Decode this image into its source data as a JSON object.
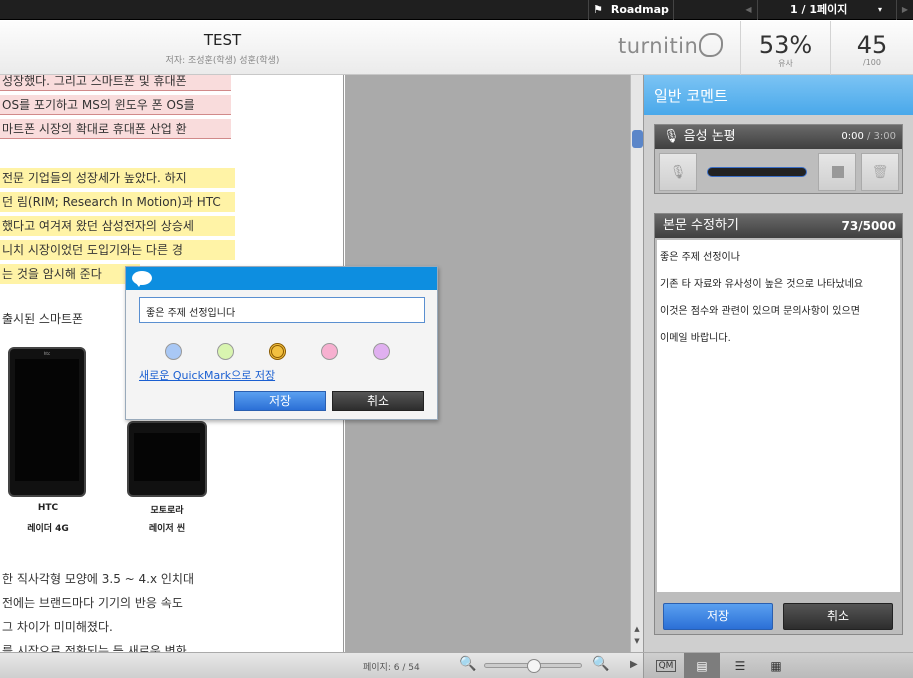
{
  "topbar": {
    "roadmap_label": "Roadmap",
    "page_label": "1 / 1페이지"
  },
  "header": {
    "title": "TEST",
    "author": "저자: 조성훈(학생) 성훈(학생)",
    "brand": "turnitin",
    "similarity_value": "53%",
    "similarity_label": "유사",
    "score_value": "45",
    "score_label": "/100"
  },
  "document": {
    "lines": [
      "성장했다. 그리고 스마트폰 및 휴대폰",
      "OS를 포기하고 MS의 윈도우 폰 OS를",
      "마트폰 시장의 확대로 휴대폰 산업 환",
      "",
      "전문 기업들의 성장세가 높았다. 하지",
      "던 림(RIM; Research In Motion)과 HTC",
      "했다고 여겨져 왔던 삼성전자의 상승세",
      " 니치 시장이었던 도입기와는 다른 경",
      "는 것을 암시해 준다",
      "",
      "출시된 스마트폰"
    ],
    "phones": [
      {
        "brand": "HTC",
        "name": "레이더 4G"
      },
      {
        "brand": "모토로라",
        "name": "레이저 씬"
      }
    ],
    "bottom_lines": [
      "한 직사각형 모양에 3.5 ~ 4.x 인치대",
      "전에는 브랜드마다 기기의 반응 속도",
      " 그 차이가 미미해졌다.",
      "를 시장으로 전환되는 등 새로운 변화"
    ]
  },
  "quickmark": {
    "input_value": "좋은 주제 선정입니다",
    "colors": [
      "#a9c8f5",
      "#d9f5b0",
      "#f2c040",
      "#f7b0d0",
      "#e0b0f0"
    ],
    "save_link": "새로운 QuickMark으로 저장",
    "save_label": "저장",
    "cancel_label": "취소"
  },
  "panel": {
    "title": "일반 코멘트",
    "voice_title": "음성 논평",
    "voice_time": "0:00",
    "voice_total": " / 3:00",
    "edit_title": "본문 수정하기",
    "edit_count": "73/5000",
    "edit_lines": [
      "좋은 주제 선정이나",
      "기존 타 자료와 유사성이 높은 것으로 나타났네요",
      "이것은 점수와 관련이 있으며 문의사항이 있으면",
      "이메일 바랍니다."
    ],
    "save_label": "저장",
    "cancel_label": "취소"
  },
  "bottom": {
    "page_info": "페이지: 6 / 54",
    "zoom_level": 0.5,
    "qm_label": "QM"
  }
}
